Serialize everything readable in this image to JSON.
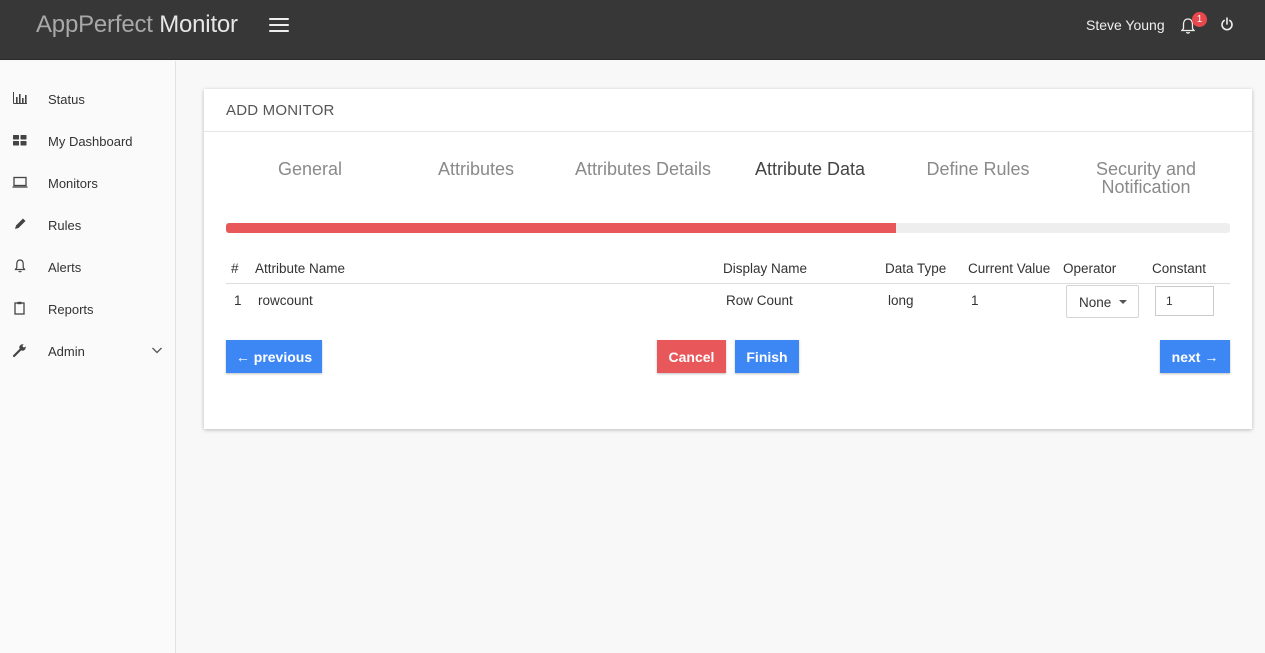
{
  "header": {
    "brand_light": "AppPerfect",
    "brand_bold": "Monitor",
    "username": "Steve Young",
    "notifications_count": "1"
  },
  "sidebar": {
    "items": [
      {
        "label": "Status",
        "icon": "bar-chart-icon"
      },
      {
        "label": "My Dashboard",
        "icon": "dashboard-grid-icon"
      },
      {
        "label": "Monitors",
        "icon": "monitor-icon"
      },
      {
        "label": "Rules",
        "icon": "pencil-icon"
      },
      {
        "label": "Alerts",
        "icon": "bell-icon"
      },
      {
        "label": "Reports",
        "icon": "clipboard-icon"
      },
      {
        "label": "Admin",
        "icon": "wrench-icon"
      }
    ]
  },
  "card": {
    "title": "ADD MONITOR",
    "steps": [
      "General",
      "Attributes",
      "Attributes Details",
      "Attribute Data",
      "Define Rules",
      "Security and Notification"
    ],
    "active_step": "Attribute Data",
    "progress_fraction": 0.667,
    "table": {
      "headers": [
        "#",
        "Attribute Name",
        "Display Name",
        "Data Type",
        "Current Value",
        "Operator",
        "Constant"
      ],
      "rows": [
        {
          "num": "1",
          "attribute_name": "rowcount",
          "display_name": "Row Count",
          "data_type": "long",
          "current_value": "1",
          "operator": "None",
          "constant": "1"
        }
      ]
    },
    "buttons": {
      "previous": "← previous",
      "cancel": "Cancel",
      "finish": "Finish",
      "next": "next →"
    }
  },
  "colors": {
    "topbar": "#373737",
    "primary": "#3d87f5",
    "danger": "#e8585b"
  }
}
